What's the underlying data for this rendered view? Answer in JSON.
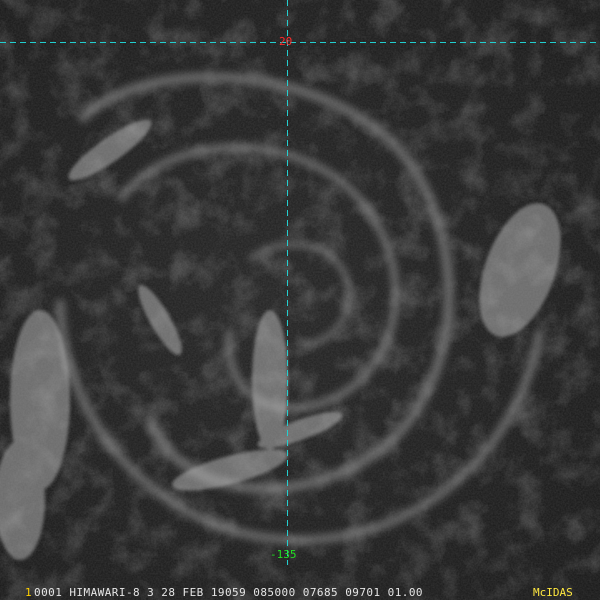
{
  "colors": {
    "grid": "#22d0d0",
    "lat_label": "#ff2a2a",
    "lon_label": "#22e022",
    "status_text": "#e6e6e6",
    "frame_number": "#ffd000",
    "brand": "#ffe840"
  },
  "grid": {
    "latitude_label": "20",
    "longitude_label": "-135"
  },
  "status": {
    "frame_number": "1",
    "text": "0001 HIMAWARI-8   3 28 FEB 19059 085000 07685 09701 01.00",
    "brand": "McIDAS"
  }
}
